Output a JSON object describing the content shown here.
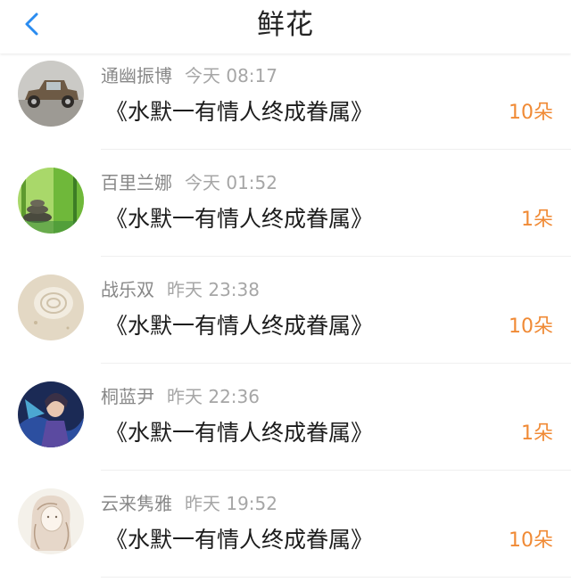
{
  "header": {
    "title": "鲜花",
    "back_icon": "chevron-left-icon"
  },
  "colors": {
    "accent": "#2a8cf0",
    "count": "#f08a35"
  },
  "items": [
    {
      "user": "通幽振博",
      "time": "今天 08:17",
      "book": "《水默一有情人终成眷属》",
      "count": "10朵",
      "avatar": "vintage-car-avatar"
    },
    {
      "user": "百里兰娜",
      "time": "今天 01:52",
      "book": "《水默一有情人终成眷属》",
      "count": "1朵",
      "avatar": "bamboo-stones-avatar"
    },
    {
      "user": "战乐双",
      "time": "昨天 23:38",
      "book": "《水默一有情人终成眷属》",
      "count": "10朵",
      "avatar": "seashell-avatar"
    },
    {
      "user": "桐蓝尹",
      "time": "昨天 22:36",
      "book": "《水默一有情人终成眷属》",
      "count": "1朵",
      "avatar": "game-hero-avatar"
    },
    {
      "user": "云来隽雅",
      "time": "昨天 19:52",
      "book": "《水默一有情人终成眷属》",
      "count": "10朵",
      "avatar": "sketch-girl-avatar"
    }
  ]
}
